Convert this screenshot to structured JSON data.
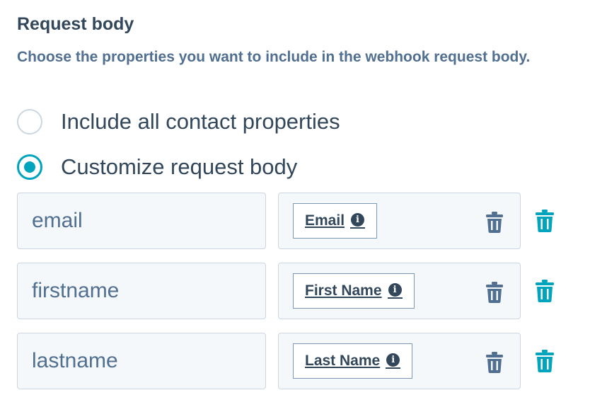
{
  "section": {
    "title": "Request body",
    "description": "Choose the properties you want to include in the webhook request body."
  },
  "options": [
    {
      "label": "Include all contact properties",
      "checked": false
    },
    {
      "label": "Customize request body",
      "checked": true
    }
  ],
  "rows": [
    {
      "key": "email",
      "token": "Email"
    },
    {
      "key": "firstname",
      "token": "First Name"
    },
    {
      "key": "lastname",
      "token": "Last Name"
    }
  ],
  "icons": {
    "inner_delete": "trash-icon",
    "outer_delete": "trash-icon",
    "token_info": "info-icon"
  },
  "colors": {
    "accent": "#00a4bd",
    "text": "#33475b",
    "muted_text": "#516f90",
    "input_bg": "#f5f8fa",
    "border": "#cbd6e2",
    "inner_trash": "#516f90"
  }
}
